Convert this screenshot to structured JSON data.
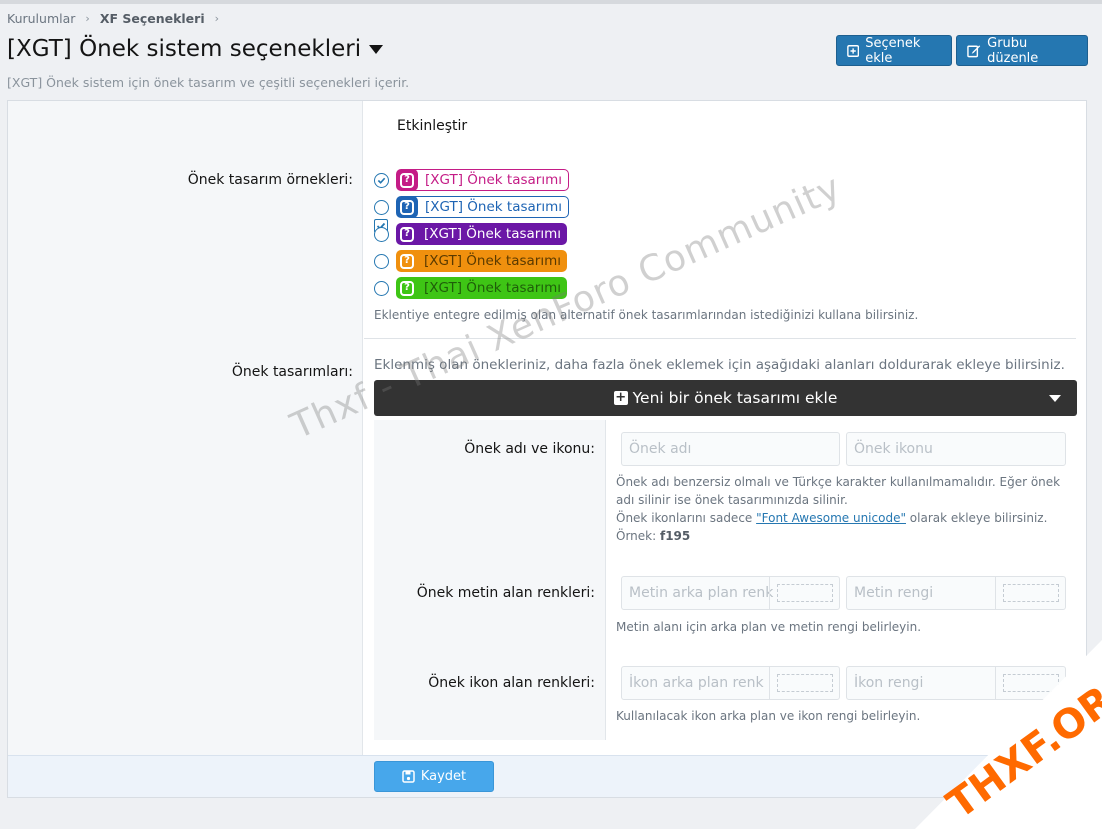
{
  "breadcrumb": {
    "item1": "Kurulumlar",
    "item2": "XF Seçenekleri"
  },
  "header": {
    "title": "[XGT] Önek sistem seçenekleri",
    "description": "[XGT] Önek sistem için önek tasarım ve çeşitli seçenekleri içerir.",
    "add_option_label": "Seçenek ekle",
    "edit_group_label": "Grubu düzenle"
  },
  "options": {
    "enable_label": "Etkinleştir",
    "samples_label": "Önek tasarım örnekleri:",
    "samples": [
      {
        "text": "[XGT] Önek tasarımı",
        "color": "#c41c86",
        "style": "outline",
        "selected": true
      },
      {
        "text": "[XGT] Önek tasarımı",
        "color": "#1e64b4",
        "style": "outline",
        "selected": false
      },
      {
        "text": "[XGT] Önek tasarımı",
        "color": "#6b17a6",
        "style": "filled",
        "selected": false
      },
      {
        "text": "[XGT] Önek tasarımı",
        "color": "#f0900e",
        "style": "filled",
        "selected": false
      },
      {
        "text": "[XGT] Önek tasarımı",
        "color": "#3ec515",
        "style": "filled",
        "selected": false
      }
    ],
    "samples_hint": "Eklentiye entegre edilmiş olan alternatif önek tasarımlarından istediğinizi kullana bilirsiniz.",
    "designs_label": "Önek tasarımları:",
    "designs_hint": "Eklenmiş olan önekleriniz, daha fazla önek eklemek için aşağıdaki alanları doldurarak ekleye bilirsiniz.",
    "add_design_label": "Yeni bir önek tasarımı ekle"
  },
  "form": {
    "name_icon_label": "Önek adı ve ikonu:",
    "name_placeholder": "Önek adı",
    "icon_placeholder": "Önek ikonu",
    "name_hint_1": "Önek adı benzersiz olmalı ve Türkçe karakter kullanılmamalıdır. Eğer önek adı silinir ise önek tasarımınızda silinir.",
    "icon_hint_prefix": "Önek ikonlarını sadece ",
    "icon_hint_link": "\"Font Awesome unicode\"",
    "icon_hint_suffix": " olarak ekleye bilirsiniz.",
    "example_label": "Örnek: ",
    "example_value": "f195",
    "text_colors_label": "Önek metin alan renkleri:",
    "text_bg_placeholder": "Metin arka plan renk",
    "text_color_placeholder": "Metin rengi",
    "text_colors_hint": "Metin alanı için arka plan ve metin rengi belirleyin.",
    "icon_colors_label": "Önek ikon alan renkleri:",
    "icon_bg_placeholder": "İkon arka plan renk",
    "icon_color_placeholder": "İkon rengi",
    "icon_colors_hint": "Kullanılacak ikon arka plan ve ikon rengi belirleyin."
  },
  "footer": {
    "save_label": "Kaydet"
  },
  "overlay": {
    "watermark": "Thxf - Thai XenForo Community",
    "logo": "THXF.ORG"
  },
  "colors": {
    "accent": "#2577b1",
    "save": "#47a7eb",
    "dark_bar": "#333333"
  }
}
